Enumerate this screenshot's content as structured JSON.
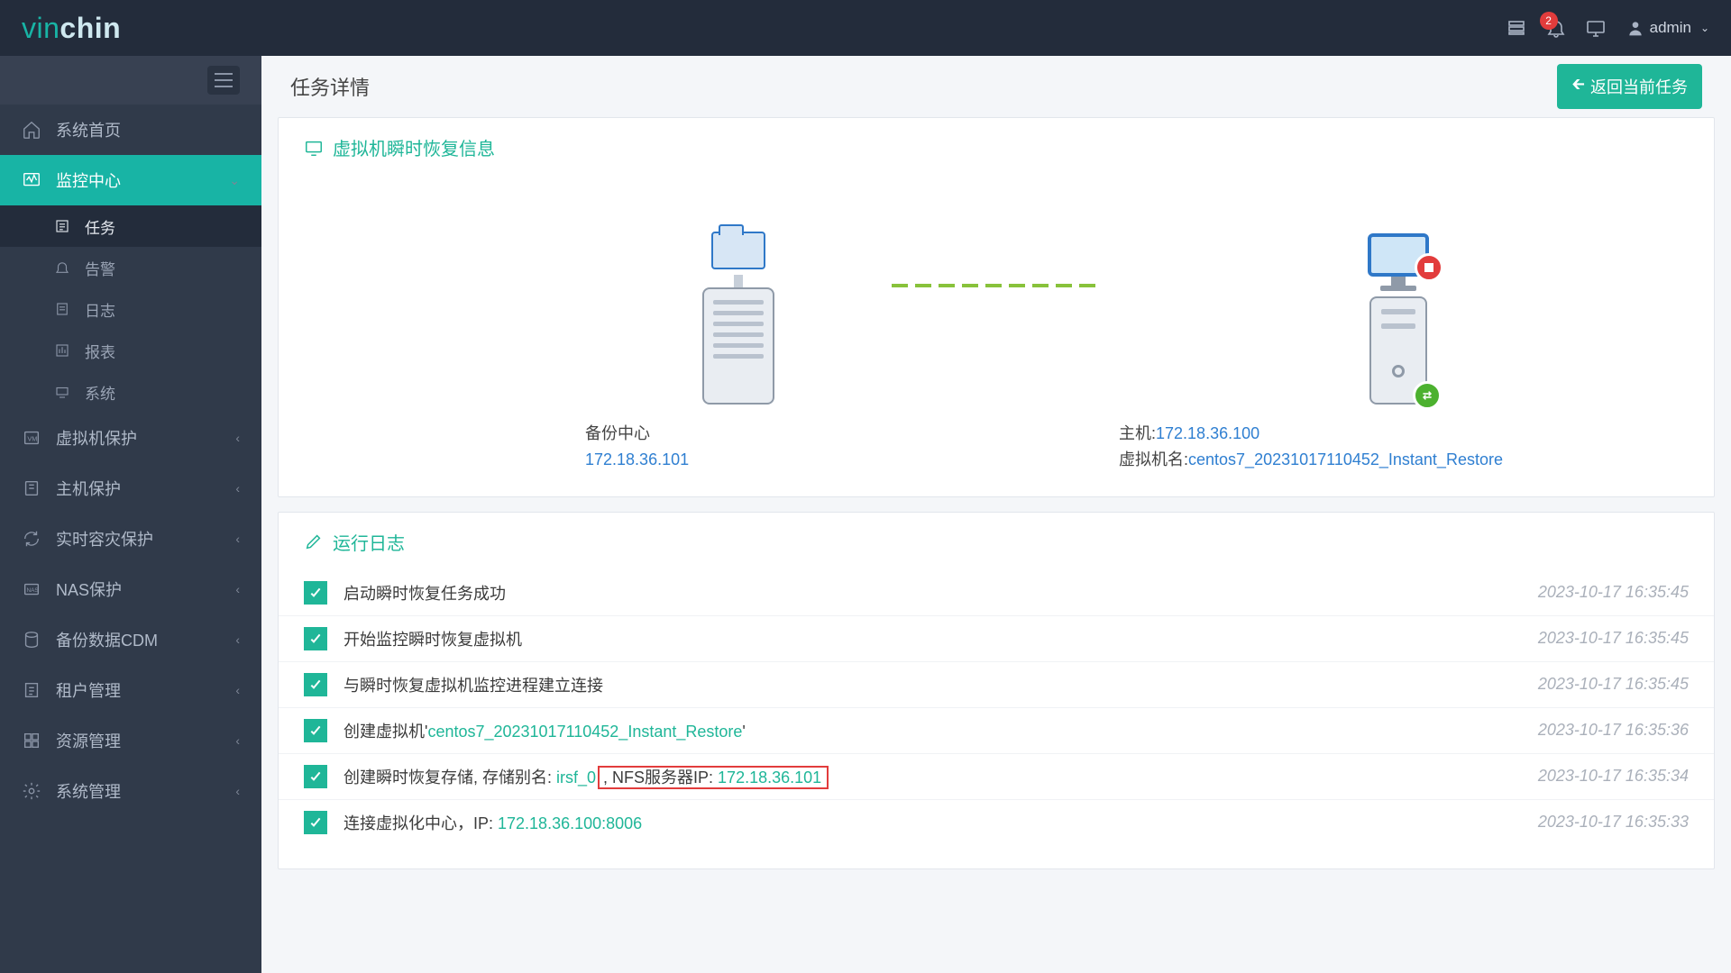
{
  "topbar": {
    "brand_thin": "vin",
    "brand_bold": "chin",
    "notif_count": "2",
    "user_label": "admin"
  },
  "sidebar": {
    "items": [
      {
        "label": "系统首页",
        "has_children": false
      },
      {
        "label": "监控中心",
        "has_children": true,
        "active": true,
        "children": [
          {
            "label": "任务",
            "current": true
          },
          {
            "label": "告警"
          },
          {
            "label": "日志"
          },
          {
            "label": "报表"
          },
          {
            "label": "系统"
          }
        ]
      },
      {
        "label": "虚拟机保护",
        "has_children": true
      },
      {
        "label": "主机保护",
        "has_children": true
      },
      {
        "label": "实时容灾保护",
        "has_children": true
      },
      {
        "label": "NAS保护",
        "has_children": true
      },
      {
        "label": "备份数据CDM",
        "has_children": true
      },
      {
        "label": "租户管理",
        "has_children": true
      },
      {
        "label": "资源管理",
        "has_children": true
      },
      {
        "label": "系统管理",
        "has_children": true
      }
    ]
  },
  "page": {
    "title": "任务详情",
    "return_btn": "返回当前任务",
    "card1_title": "虚拟机瞬时恢复信息",
    "card2_title": "运行日志"
  },
  "diagram": {
    "left_label": "备份中心",
    "left_link": "172.18.36.101",
    "right_host_prefix": "主机:",
    "right_host_link": "172.18.36.100",
    "right_vm_prefix": "虚拟机名:",
    "right_vm_link": "centos7_20231017110452_Instant_Restore"
  },
  "logs": [
    {
      "msg_plain": "启动瞬时恢复任务成功",
      "time": "2023-10-17 16:35:45"
    },
    {
      "msg_plain": "开始监控瞬时恢复虚拟机",
      "time": "2023-10-17 16:35:45"
    },
    {
      "msg_plain": "与瞬时恢复虚拟机监控进程建立连接",
      "time": "2023-10-17 16:35:45"
    },
    {
      "msg_pre": "创建虚拟机'",
      "msg_green": "centos7_20231017110452_Instant_Restore",
      "msg_post": "'",
      "time": "2023-10-17 16:35:36"
    },
    {
      "msg_pre": "创建瞬时恢复存储, 存储别名: ",
      "msg_green": "irsf_0",
      "boxed_pre": ", NFS服务器IP: ",
      "boxed_green": "172.18.36.101",
      "time": "2023-10-17 16:35:34"
    },
    {
      "msg_pre": "连接虚拟化中心，IP: ",
      "msg_green": "172.18.36.100:8006",
      "time": "2023-10-17 16:35:33"
    }
  ]
}
